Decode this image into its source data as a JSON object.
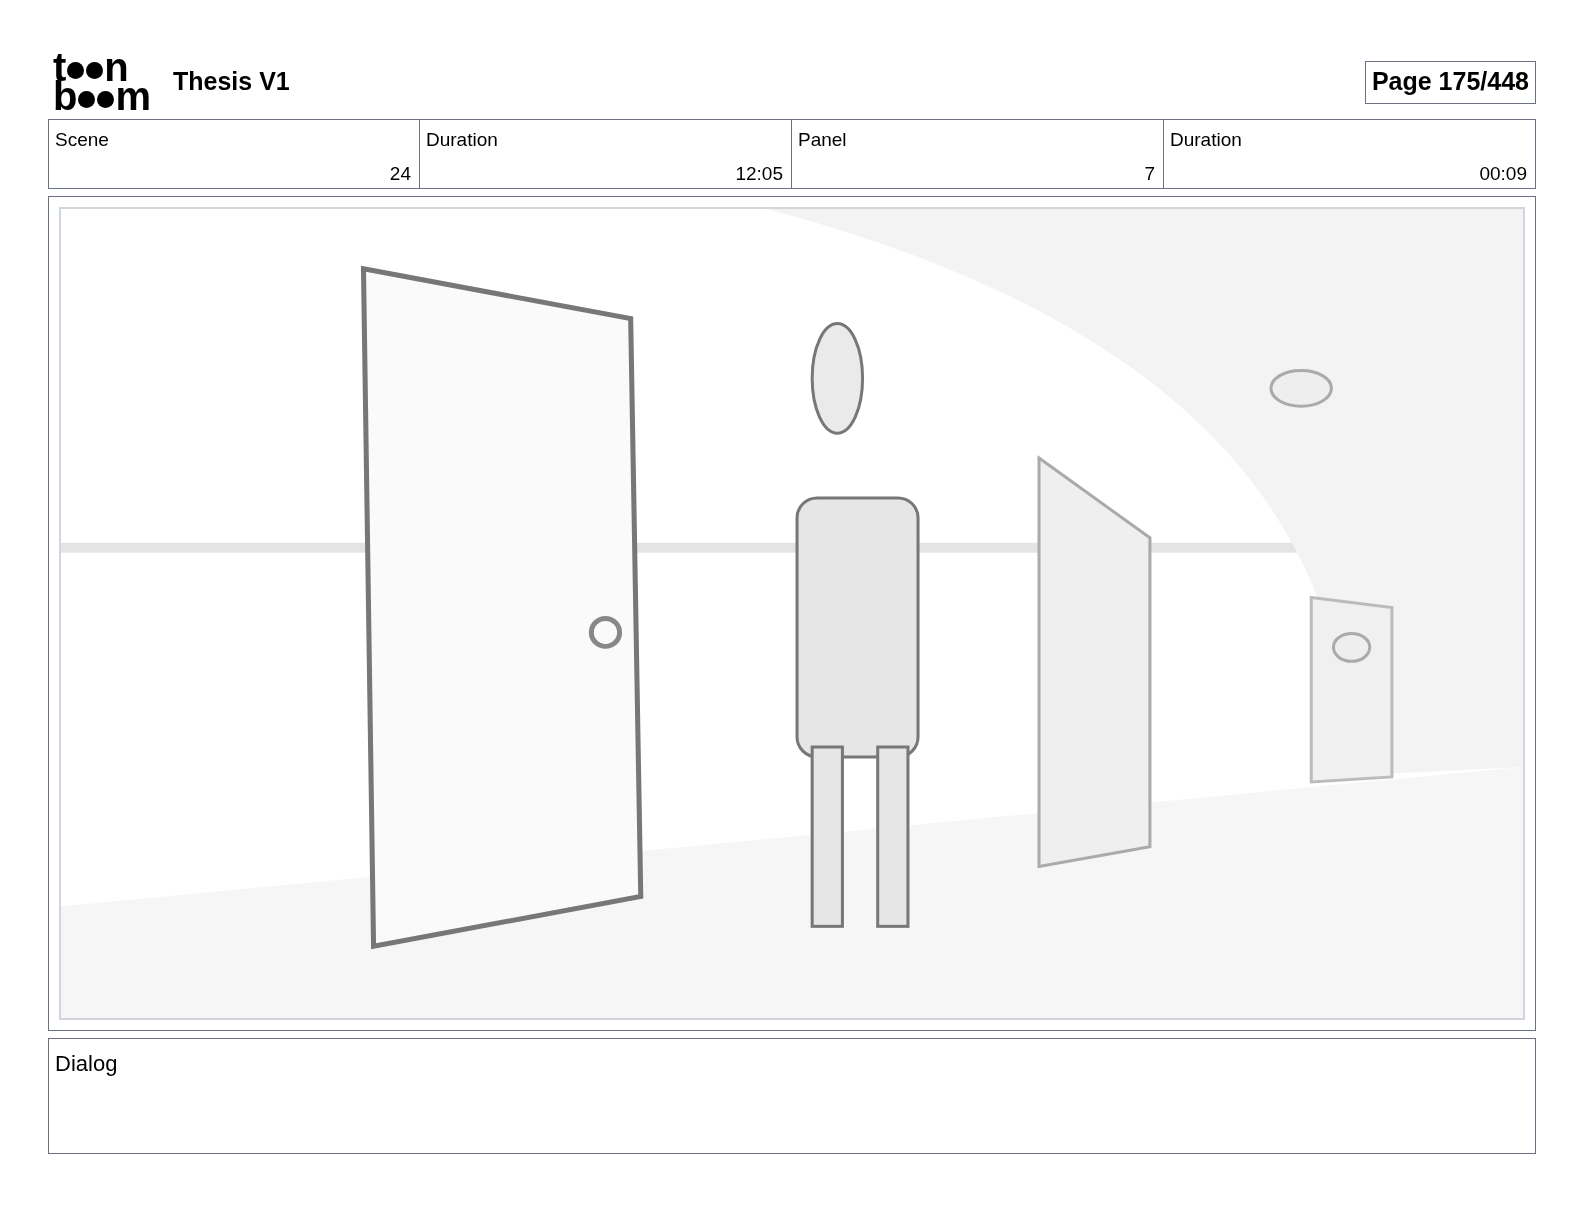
{
  "header": {
    "logo": {
      "line1": [
        "t",
        "n"
      ],
      "line2": [
        "b",
        "m"
      ]
    },
    "title": "Thesis V1",
    "page": "Page 175/448"
  },
  "info_table": {
    "columns": [
      "Scene",
      "Duration",
      "Panel",
      "Duration"
    ],
    "values": [
      "24",
      "12:05",
      "7",
      "00:09"
    ]
  },
  "dialog": {
    "label": "Dialog"
  }
}
